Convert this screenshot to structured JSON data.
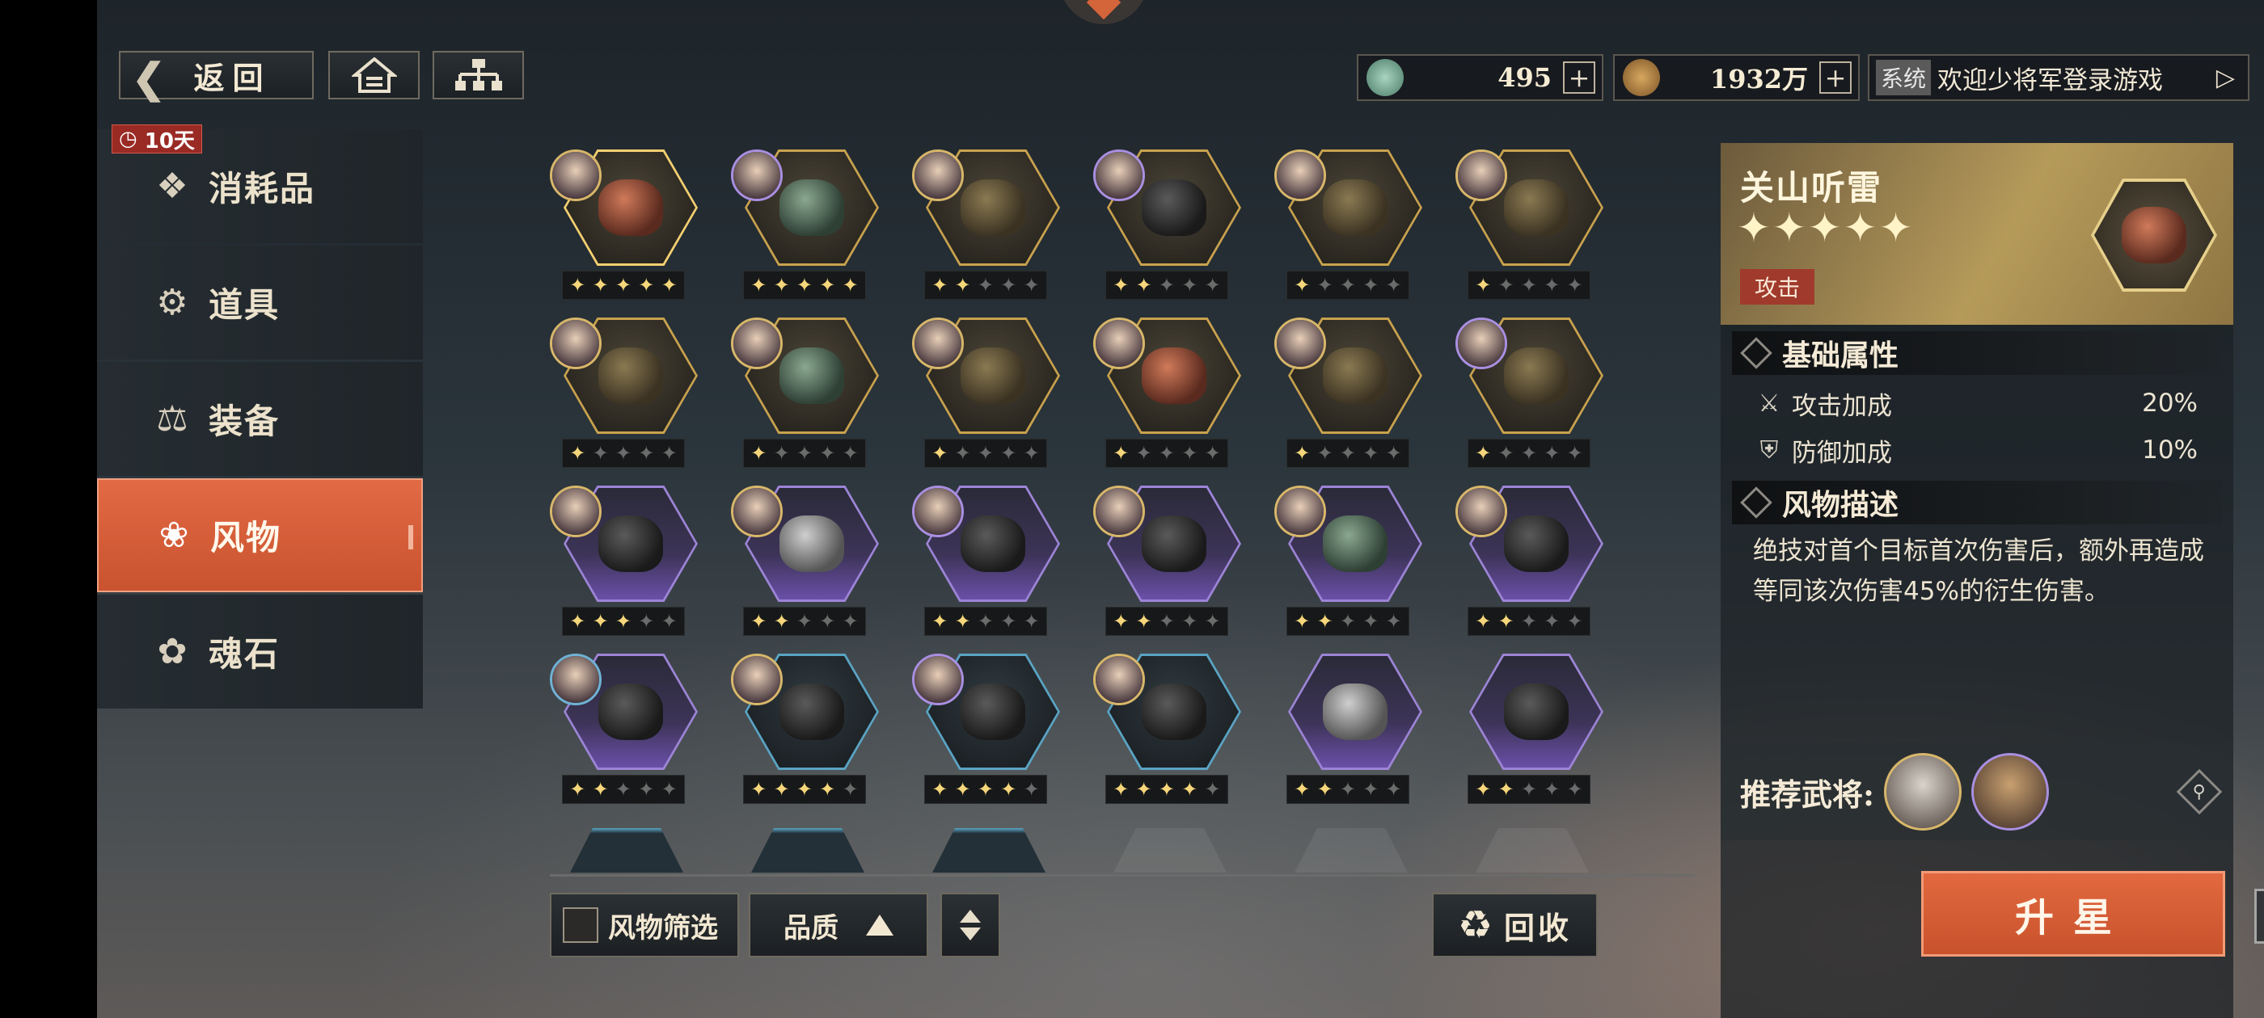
{
  "nav": {
    "back_label": "返回",
    "back_icon": "arrow-left-icon",
    "home_icon": "home-icon",
    "tree_icon": "hierarchy-icon"
  },
  "currency": [
    {
      "icon": "jade-coin-icon",
      "value": "495",
      "color": "#7fb8a0"
    },
    {
      "icon": "copper-coin-icon",
      "value": "1932万",
      "color": "#b98a4a"
    }
  ],
  "system": {
    "tag": "系统",
    "message": "欢迎少将军登录游戏"
  },
  "categories": [
    {
      "label": "消耗品",
      "icon": "consumable-icon",
      "badge": "10天"
    },
    {
      "label": "道具",
      "icon": "item-icon"
    },
    {
      "label": "装备",
      "icon": "equipment-icon"
    },
    {
      "label": "风物",
      "icon": "relic-icon",
      "active": true
    },
    {
      "label": "魂石",
      "icon": "soulstone-icon"
    }
  ],
  "relics": [
    {
      "stars": 5,
      "quality": "gold",
      "avatar": "gold",
      "look": "red",
      "selected": true
    },
    {
      "stars": 5,
      "quality": "gold",
      "avatar": "pu",
      "look": "jade"
    },
    {
      "stars": 2,
      "quality": "gold",
      "avatar": "gold",
      "look": "gold"
    },
    {
      "stars": 2,
      "quality": "gold",
      "avatar": "pu",
      "look": "dark"
    },
    {
      "stars": 1,
      "quality": "gold",
      "avatar": "gold",
      "look": "gold"
    },
    {
      "stars": 1,
      "quality": "gold",
      "avatar": "gold",
      "look": "gold"
    },
    {
      "stars": 1,
      "quality": "gold",
      "avatar": "gold",
      "look": "gold"
    },
    {
      "stars": 1,
      "quality": "gold",
      "avatar": "gold",
      "look": "jade"
    },
    {
      "stars": 1,
      "quality": "gold",
      "avatar": "gold",
      "look": "gold"
    },
    {
      "stars": 1,
      "quality": "gold",
      "avatar": "gold",
      "look": "red"
    },
    {
      "stars": 1,
      "quality": "gold",
      "avatar": "gold",
      "look": "gold"
    },
    {
      "stars": 1,
      "quality": "gold",
      "avatar": "pu",
      "look": "gold"
    },
    {
      "stars": 3,
      "quality": "purple",
      "avatar": "gold",
      "look": "dark"
    },
    {
      "stars": 2,
      "quality": "purple",
      "avatar": "gold",
      "look": "silver"
    },
    {
      "stars": 2,
      "quality": "purple",
      "avatar": "pu",
      "look": "dark"
    },
    {
      "stars": 2,
      "quality": "purple",
      "avatar": "gold",
      "look": "dark"
    },
    {
      "stars": 2,
      "quality": "purple",
      "avatar": "gold",
      "look": "jade"
    },
    {
      "stars": 2,
      "quality": "purple",
      "avatar": "gold",
      "look": "dark"
    },
    {
      "stars": 2,
      "quality": "purple",
      "avatar": "bl",
      "look": "dark"
    },
    {
      "stars": 4,
      "quality": "blue",
      "avatar": "gold",
      "look": "dark"
    },
    {
      "stars": 4,
      "quality": "blue",
      "avatar": "pu",
      "look": "dark"
    },
    {
      "stars": 4,
      "quality": "blue",
      "avatar": "gold",
      "look": "dark"
    },
    {
      "stars": 2,
      "quality": "purple",
      "avatar": "",
      "look": "silver"
    },
    {
      "stars": 2,
      "quality": "purple",
      "avatar": "",
      "look": "dark"
    }
  ],
  "bottom": {
    "filter_label": "风物筛选",
    "quality_label": "品质",
    "recycle_label": "回收",
    "recycle_icon": "recycle-icon",
    "sort_icon": "sort-toggle-icon"
  },
  "detail": {
    "name": "关山听雷",
    "stars": "✦✦✦✦✦",
    "tag": "攻击",
    "section_attrs": "基础属性",
    "attrs": [
      {
        "icon": "attack-icon",
        "name": "攻击加成",
        "value": "20%"
      },
      {
        "icon": "defense-icon",
        "name": "防御加成",
        "value": "10%"
      }
    ],
    "section_desc": "风物描述",
    "description": "绝技对首个目标首次伤害后，额外再造成等同该次伤害45%的衍生伤害。",
    "recommend_label": "推荐武将:",
    "upgrade_label": "升星"
  },
  "colors": {
    "accent": "#d85d35",
    "gold_frame": "#c9a24e",
    "purple_frame": "#9d84d6",
    "blue_frame": "#5aa4c4"
  }
}
